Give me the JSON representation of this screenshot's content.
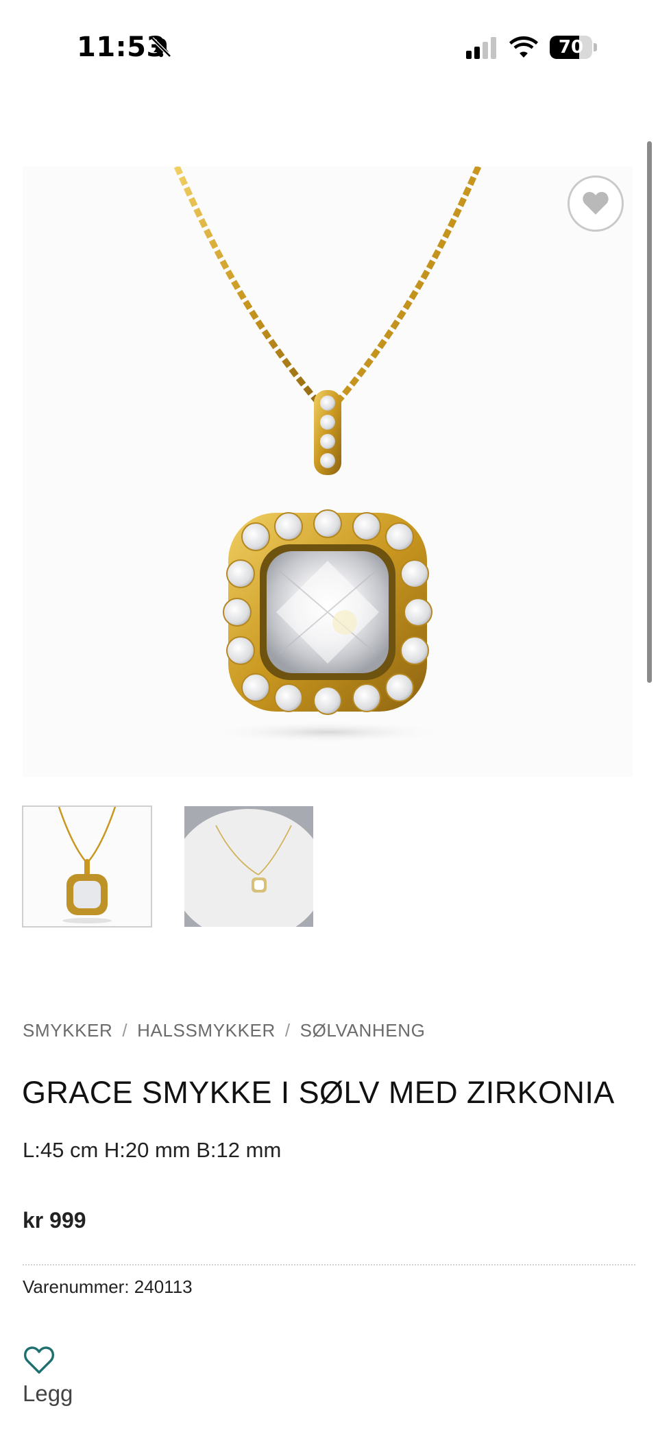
{
  "status_bar": {
    "time": "11:53",
    "battery_percent": "70",
    "battery_level": 0.7,
    "icons": [
      "bell-slash-icon",
      "cellular-signal-icon",
      "wifi-icon",
      "battery-icon"
    ]
  },
  "gallery": {
    "main_image_alt": "pendant-image",
    "wishlist_icon": "heart-icon",
    "thumbnails": [
      "thumbnail-pendant",
      "thumbnail-pendant-display"
    ]
  },
  "breadcrumb": {
    "items": [
      "SMYKKER",
      "HALSSMYKKER",
      "SØLVANHENG"
    ],
    "separator": "/"
  },
  "product": {
    "title": "GRACE SMYKKE I SØLV MED ZIRKONIA",
    "dimensions": "L:45 cm H:20 mm B:12 mm",
    "price": "kr 999",
    "sku": "Varenummer: 240113"
  },
  "wishlist": {
    "label": "Legg"
  },
  "colors": {
    "gold": "#d4a72c",
    "wishlist_accent": "#1f6f6f",
    "text": "#1a1a1a",
    "muted": "#6b6b6b"
  }
}
